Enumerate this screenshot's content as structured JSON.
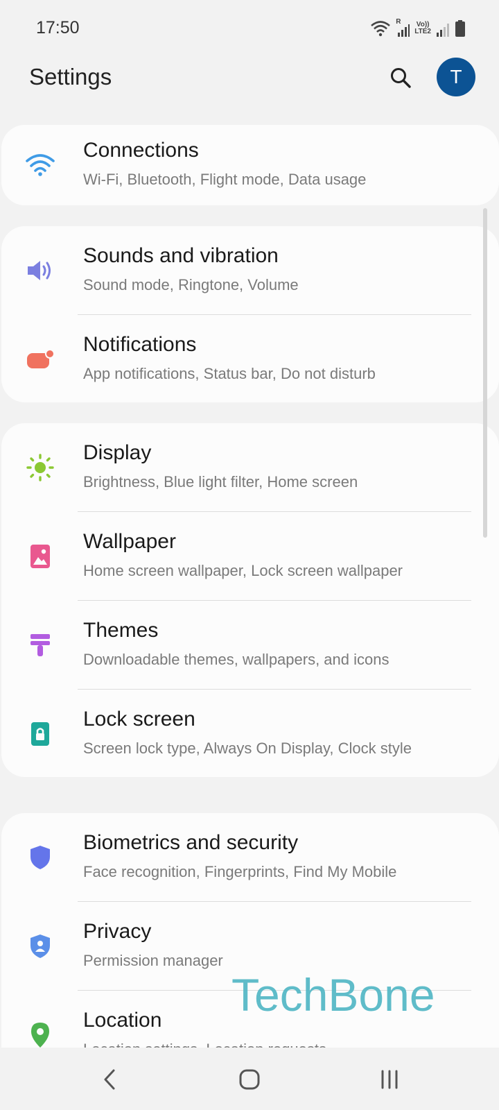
{
  "status_bar": {
    "time": "17:50",
    "lte_line1": "Vo))",
    "lte_line2": "LTE2",
    "r_indicator": "R"
  },
  "header": {
    "title": "Settings",
    "avatar_initial": "T"
  },
  "groups": [
    {
      "items": [
        {
          "title": "Connections",
          "subtitle": "Wi-Fi, Bluetooth, Flight mode, Data usage",
          "icon": "wifi-icon",
          "color": "#3f9be6"
        }
      ]
    },
    {
      "items": [
        {
          "title": "Sounds and vibration",
          "subtitle": "Sound mode, Ringtone, Volume",
          "icon": "volume-icon",
          "color": "#7b7fe0"
        },
        {
          "title": "Notifications",
          "subtitle": "App notifications, Status bar, Do not disturb",
          "icon": "notification-icon",
          "color": "#f0725f"
        }
      ]
    },
    {
      "items": [
        {
          "title": "Display",
          "subtitle": "Brightness, Blue light filter, Home screen",
          "icon": "brightness-icon",
          "color": "#8bc833"
        },
        {
          "title": "Wallpaper",
          "subtitle": "Home screen wallpaper, Lock screen wallpaper",
          "icon": "wallpaper-icon",
          "color": "#e9588f"
        },
        {
          "title": "Themes",
          "subtitle": "Downloadable themes, wallpapers, and icons",
          "icon": "themes-icon",
          "color": "#b25ce0"
        },
        {
          "title": "Lock screen",
          "subtitle": "Screen lock type, Always On Display, Clock style",
          "icon": "lock-icon",
          "color": "#1ea89a"
        }
      ]
    },
    {
      "items": [
        {
          "title": "Biometrics and security",
          "subtitle": "Face recognition, Fingerprints, Find My Mobile",
          "icon": "shield-icon",
          "color": "#6475ea"
        },
        {
          "title": "Privacy",
          "subtitle": "Permission manager",
          "icon": "privacy-icon",
          "color": "#5b8fe8"
        },
        {
          "title": "Location",
          "subtitle": "Location settings, Location requests",
          "icon": "location-pin-icon",
          "color": "#4db24f"
        }
      ]
    }
  ],
  "watermark": "TechBone"
}
